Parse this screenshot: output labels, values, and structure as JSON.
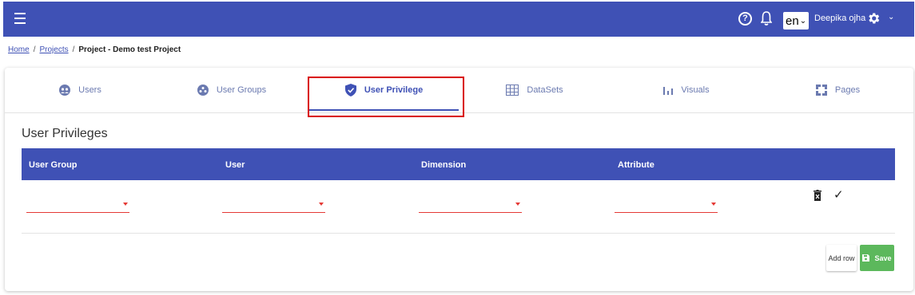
{
  "header": {
    "language": "en",
    "user_name": "Deepika ojha",
    "help_glyph": "?",
    "menu_icon": "hamburger-menu-icon",
    "accent_color": "#3f51b5"
  },
  "breadcrumb": {
    "home": "Home",
    "separator": "/",
    "projects": "Projects",
    "current": "Project - Demo test Project"
  },
  "tabs": [
    {
      "label": "Users",
      "icon": "users-icon"
    },
    {
      "label": "User Groups",
      "icon": "user-groups-icon"
    },
    {
      "label": "User Privilege",
      "icon": "shield-check-icon",
      "active": true
    },
    {
      "label": "DataSets",
      "icon": "dataset-icon"
    },
    {
      "label": "Visuals",
      "icon": "bar-chart-icon"
    },
    {
      "label": "Pages",
      "icon": "pages-icon"
    }
  ],
  "section": {
    "title": "User Privileges"
  },
  "table": {
    "columns": [
      "User Group",
      "User",
      "Dimension",
      "Attribute"
    ],
    "row": {
      "user_group": "",
      "user": "",
      "dimension": "",
      "attribute": "",
      "confirm_glyph": "✓"
    }
  },
  "actions": {
    "add_row": "Add row",
    "save": "Save"
  },
  "colors": {
    "primary": "#3f51b5",
    "save_button": "#5cb85c",
    "field_underline": "#e53935",
    "highlight": "#d90000"
  }
}
